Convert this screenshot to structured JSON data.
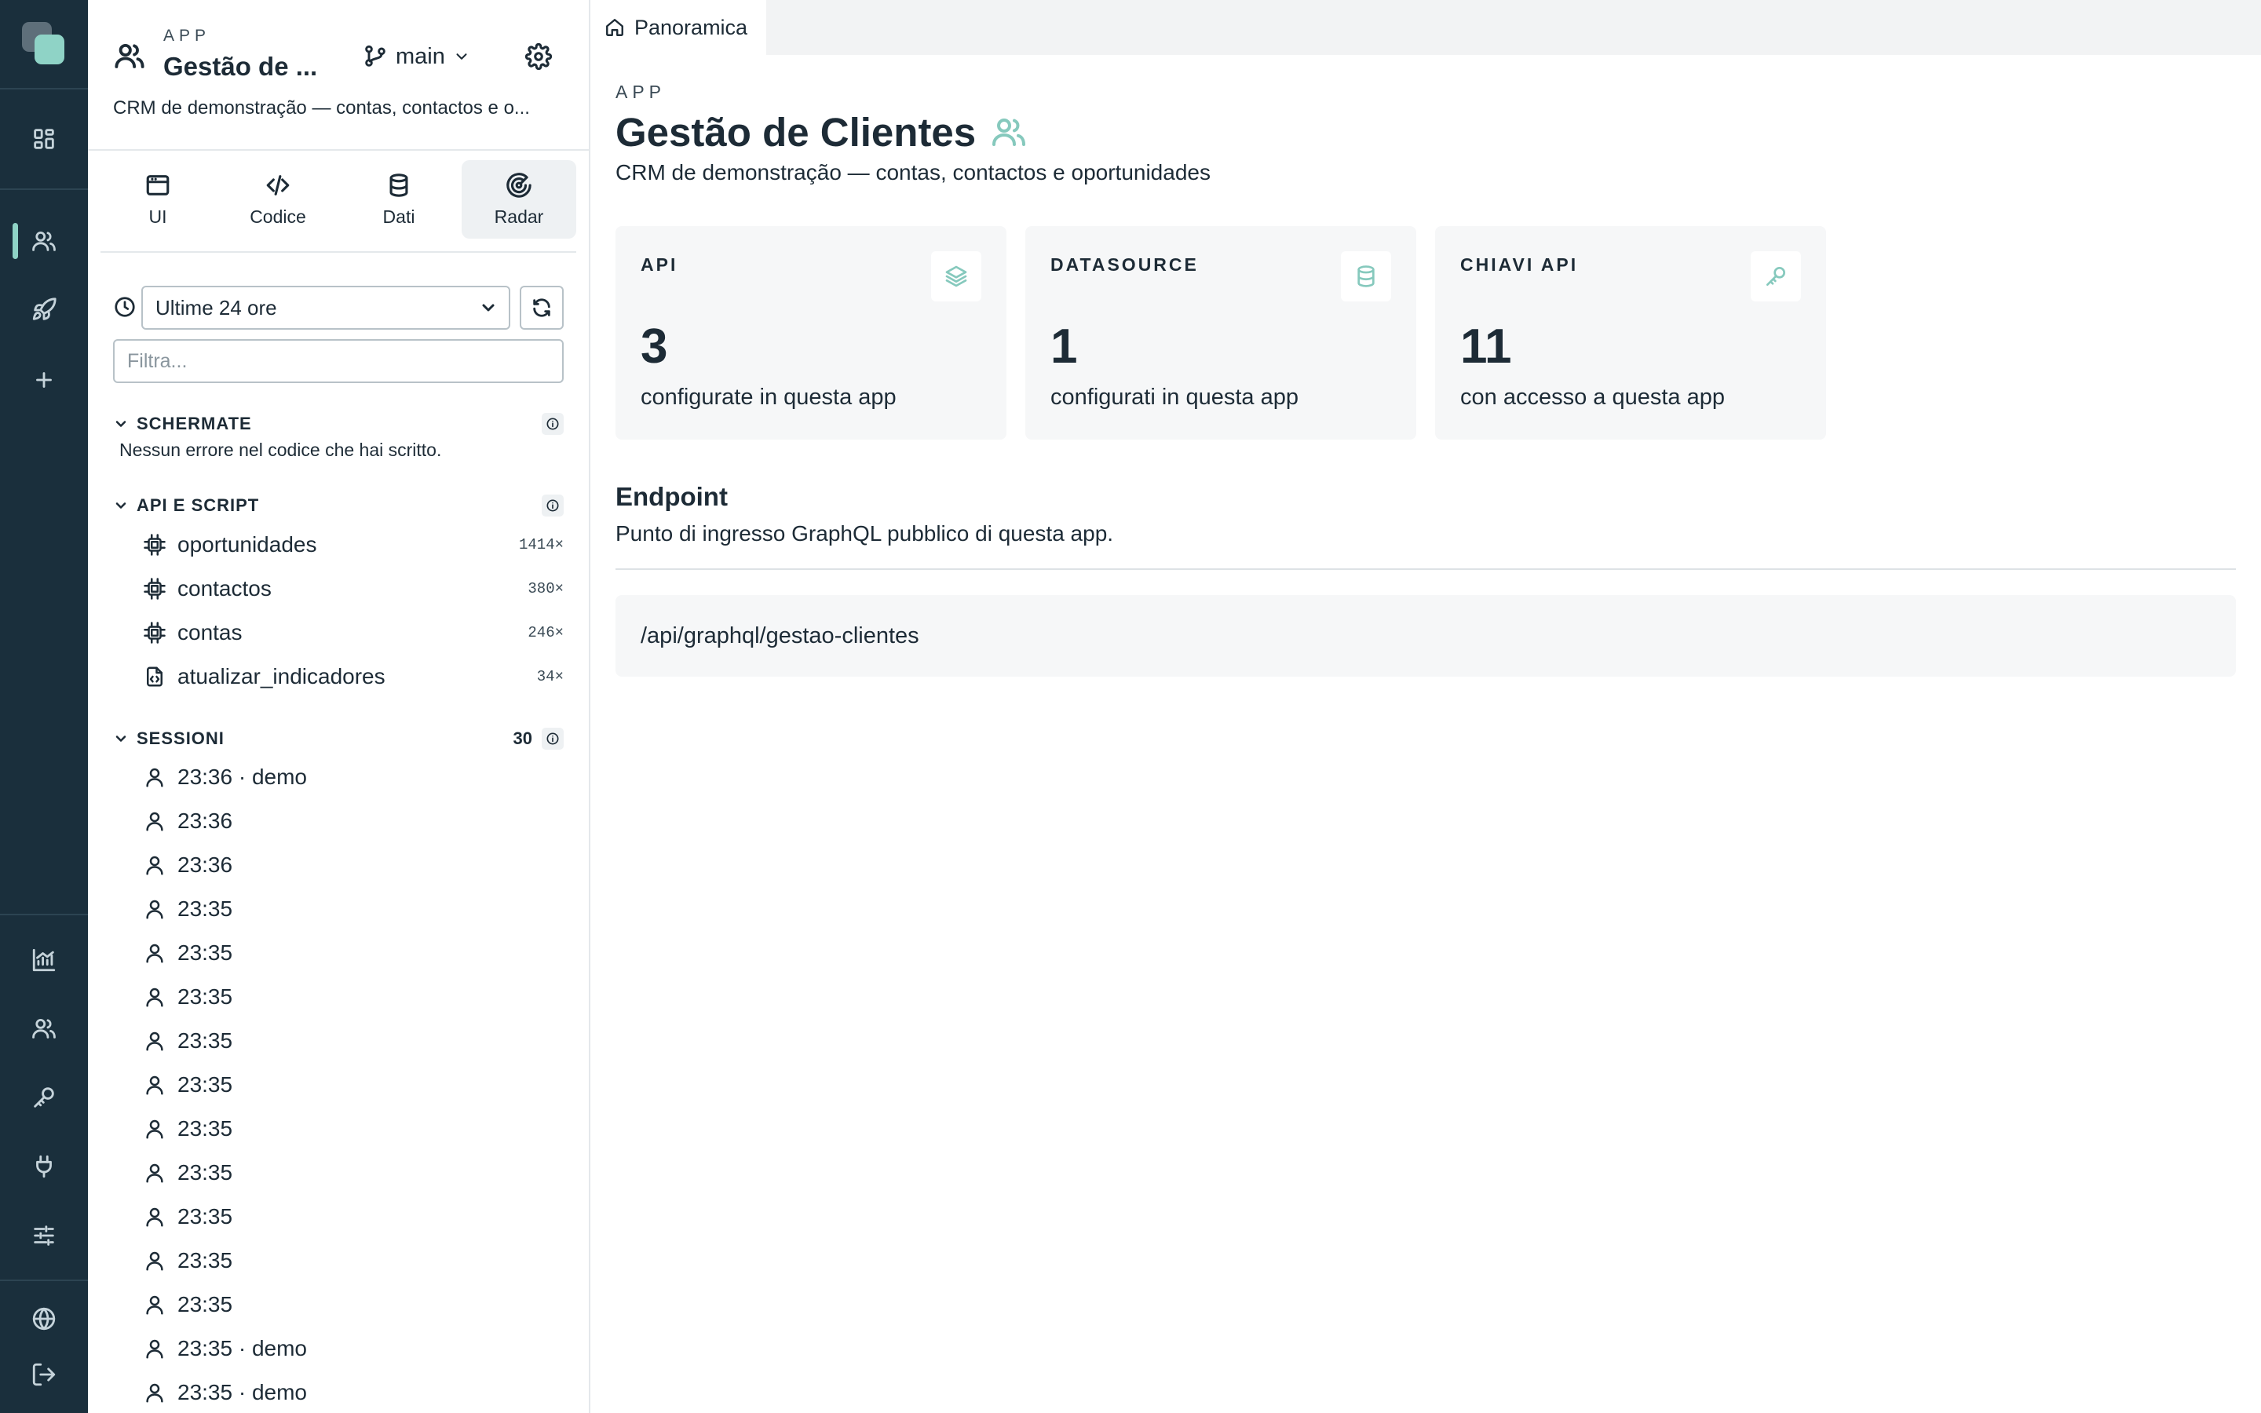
{
  "panel": {
    "kicker": "APP",
    "app_name": "Gestão de ...",
    "branch": "main",
    "description": "CRM de demonstração — contas, contactos e o...",
    "tabs": [
      {
        "label": "UI",
        "icon": "browser-window-icon"
      },
      {
        "label": "Codice",
        "icon": "code-icon"
      },
      {
        "label": "Dati",
        "icon": "database-icon"
      },
      {
        "label": "Radar",
        "icon": "radar-icon",
        "active": true
      }
    ],
    "range": {
      "selected": "Ultime 24 ore"
    },
    "filter": {
      "placeholder": "Filtra..."
    },
    "sections": {
      "screens": {
        "title": "SCHERMATE",
        "empty": "Nessun errore nel codice che hai scritto."
      },
      "apis": {
        "title": "API E SCRIPT",
        "items": [
          {
            "label": "oportunidades",
            "count": "1414×",
            "icon": "chip-icon"
          },
          {
            "label": "contactos",
            "count": "380×",
            "icon": "chip-icon"
          },
          {
            "label": "contas",
            "count": "246×",
            "icon": "chip-icon"
          },
          {
            "label": "atualizar_indicadores",
            "count": "34×",
            "icon": "script-file-icon"
          }
        ]
      },
      "sessions": {
        "title": "SESSIONI",
        "count": "30",
        "items": [
          "23:36 · demo",
          "23:36",
          "23:36",
          "23:35",
          "23:35",
          "23:35",
          "23:35",
          "23:35",
          "23:35",
          "23:35",
          "23:35",
          "23:35",
          "23:35",
          "23:35 · demo",
          "23:35 · demo"
        ]
      }
    }
  },
  "main": {
    "tab_label": "Panoramica",
    "kicker": "APP",
    "title": "Gestão de Clientes",
    "subtitle": "CRM de demonstração — contas, contactos e oportunidades",
    "cards": [
      {
        "label": "API",
        "value": "3",
        "caption": "configurate in questa app",
        "icon": "layers-icon"
      },
      {
        "label": "DATASOURCE",
        "value": "1",
        "caption": "configurati in questa app",
        "icon": "database-icon"
      },
      {
        "label": "CHIAVI API",
        "value": "11",
        "caption": "con accesso a questa app",
        "icon": "key-icon"
      }
    ],
    "endpoint": {
      "heading": "Endpoint",
      "subtitle": "Punto di ingresso GraphQL pubblico di questa app.",
      "path": "/api/graphql/gestao-clientes"
    }
  },
  "colors": {
    "rail_bg": "#1a2f3c",
    "accent": "#8fd3c6",
    "card_bg": "#f6f7f8"
  }
}
